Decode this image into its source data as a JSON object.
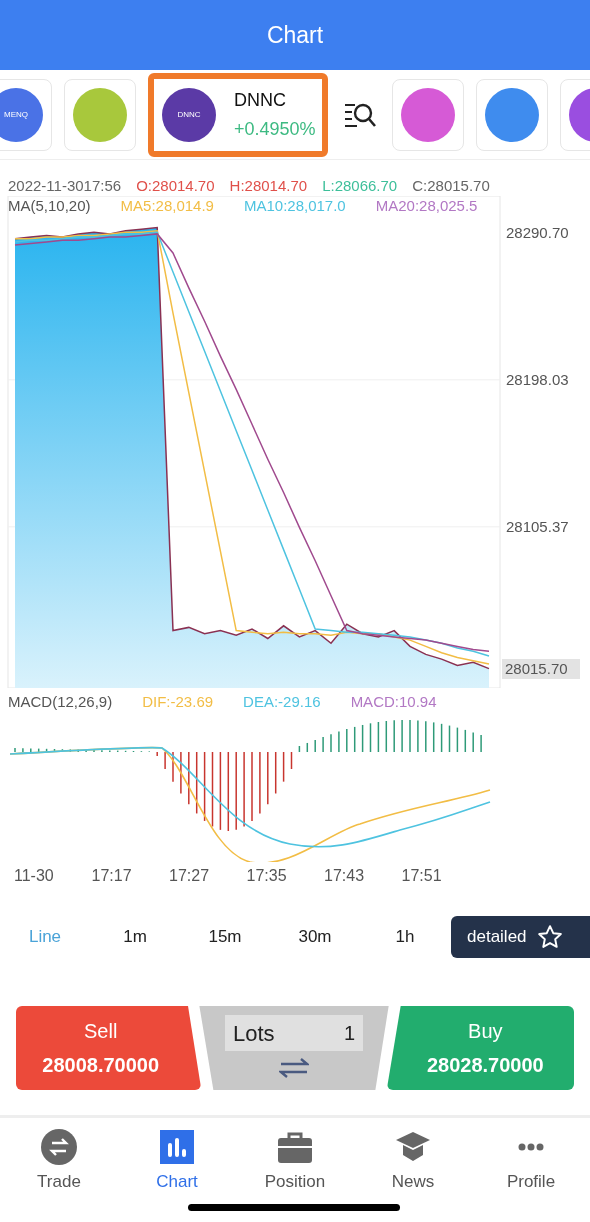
{
  "header": {
    "title": "Chart"
  },
  "symbols": [
    {
      "kind": "coin",
      "badge": "MENQ",
      "color": "#4a72e6",
      "selected": false
    },
    {
      "kind": "coin",
      "color": "#a8c83c",
      "selected": false
    },
    {
      "kind": "coin",
      "badge": "DNNC",
      "name": "DNNC",
      "change": "+0.4950%",
      "color": "#5b3aa6",
      "selected": true
    },
    {
      "kind": "search"
    },
    {
      "kind": "coin",
      "color": "#d65ad6",
      "selected": false
    },
    {
      "kind": "coin",
      "color": "#3f8cee",
      "selected": false
    },
    {
      "kind": "coin",
      "color": "#9a4ee0",
      "selected": false
    }
  ],
  "quote_line": [
    {
      "text": "2022-11-3017:56",
      "color": "#666666"
    },
    {
      "text": "O:28014.70",
      "color": "#e0504a"
    },
    {
      "text": "H:28014.70",
      "color": "#e0504a"
    },
    {
      "text": "L:28066.70",
      "color": "#3dbf9a"
    },
    {
      "text": "C:28015.70",
      "color": "#666666"
    }
  ],
  "ma_legend": [
    {
      "text": "MA(5,10,20)",
      "color": "#555555"
    },
    {
      "text": "MA5:28,014.9",
      "color": "#f2bd45"
    },
    {
      "text": "MA10:28,017.0",
      "color": "#4ec3e0"
    },
    {
      "text": "MA20:28,025.5",
      "color": "#b278c4"
    }
  ],
  "price_chart": {
    "chart_data": {
      "type": "line",
      "ylim": [
        28003.8,
        28313.9
      ],
      "yticks": [
        {
          "value": 28290.7,
          "label": "28290.70"
        },
        {
          "value": 28198.03,
          "label": "28198.03"
        },
        {
          "value": 28105.37,
          "label": "28105.37"
        },
        {
          "value": 28015.7,
          "label": "28015.70"
        }
      ],
      "series": [
        {
          "type": "area",
          "color": "#8a3152",
          "values": [
            28287,
            28288,
            28289,
            28288,
            28290,
            28291,
            28290,
            28292,
            28293,
            28294,
            28040,
            28042,
            28038,
            28040,
            28037,
            28041,
            28035,
            28043,
            28036,
            28040,
            28032,
            28044,
            28038,
            28036,
            28040,
            28030,
            28025,
            28022,
            28018,
            28020,
            28016
          ]
        },
        {
          "type": "line",
          "color": "#f2bd45",
          "values": [
            28287,
            28287,
            28288,
            28288,
            28289,
            28289,
            28290,
            28291,
            28291,
            28292,
            28240,
            28190,
            28140,
            28090,
            28040,
            28039,
            28038,
            28039,
            28038,
            28038,
            28037,
            28039,
            28038,
            28038,
            28036,
            28034,
            28030,
            28026,
            28023,
            28021,
            28019
          ]
        },
        {
          "type": "line",
          "color": "#4ec3e0",
          "values": [
            28285,
            28286,
            28286,
            28287,
            28288,
            28288,
            28289,
            28290,
            28290,
            28291,
            28266,
            28241,
            28216,
            28191,
            28166,
            28141,
            28116,
            28091,
            28066,
            28041,
            28040,
            28039,
            28039,
            28038,
            28037,
            28036,
            28034,
            28032,
            28029,
            28027,
            28024
          ]
        },
        {
          "type": "line",
          "color": "#a04a8e",
          "values": [
            28283,
            28284,
            28285,
            28286,
            28286,
            28287,
            28288,
            28288,
            28289,
            28290,
            28278,
            28256,
            28235,
            28213,
            28192,
            28170,
            28148,
            28127,
            28105,
            28084,
            28062,
            28040,
            28038,
            28037,
            28036,
            28035,
            28034,
            28032,
            28030,
            28028,
            28027
          ]
        }
      ]
    }
  },
  "macd_legend": [
    {
      "text": "MACD(12,26,9)",
      "color": "#555555"
    },
    {
      "text": "DIF:-23.69",
      "color": "#f2bd45"
    },
    {
      "text": "DEA:-29.16",
      "color": "#4ec3e0"
    },
    {
      "text": "MACD:10.94",
      "color": "#b278c4"
    }
  ],
  "time_axis": [
    "11-30",
    "17:17",
    "17:27",
    "17:35",
    "17:43",
    "17:51"
  ],
  "periods": [
    {
      "kind": "tab",
      "label": "Line",
      "selected": true
    },
    {
      "kind": "tab",
      "label": "1m",
      "selected": false
    },
    {
      "kind": "tab",
      "label": "15m",
      "selected": false
    },
    {
      "kind": "tab",
      "label": "30m",
      "selected": false
    },
    {
      "kind": "tab",
      "label": "1h",
      "selected": false
    },
    {
      "kind": "button",
      "label": "detailed"
    }
  ],
  "trade": {
    "sell": {
      "label": "Sell",
      "price": "28008.70000"
    },
    "lots": {
      "label": "Lots",
      "value": "1"
    },
    "buy": {
      "label": "Buy",
      "price": "28028.70000"
    }
  },
  "nav": [
    {
      "kind": "trade",
      "label": "Trade",
      "selected": false
    },
    {
      "kind": "chart",
      "label": "Chart",
      "selected": true
    },
    {
      "kind": "position",
      "label": "Position",
      "selected": false
    },
    {
      "kind": "news",
      "label": "News",
      "selected": false
    },
    {
      "kind": "profile",
      "label": "Profile",
      "selected": false
    }
  ]
}
